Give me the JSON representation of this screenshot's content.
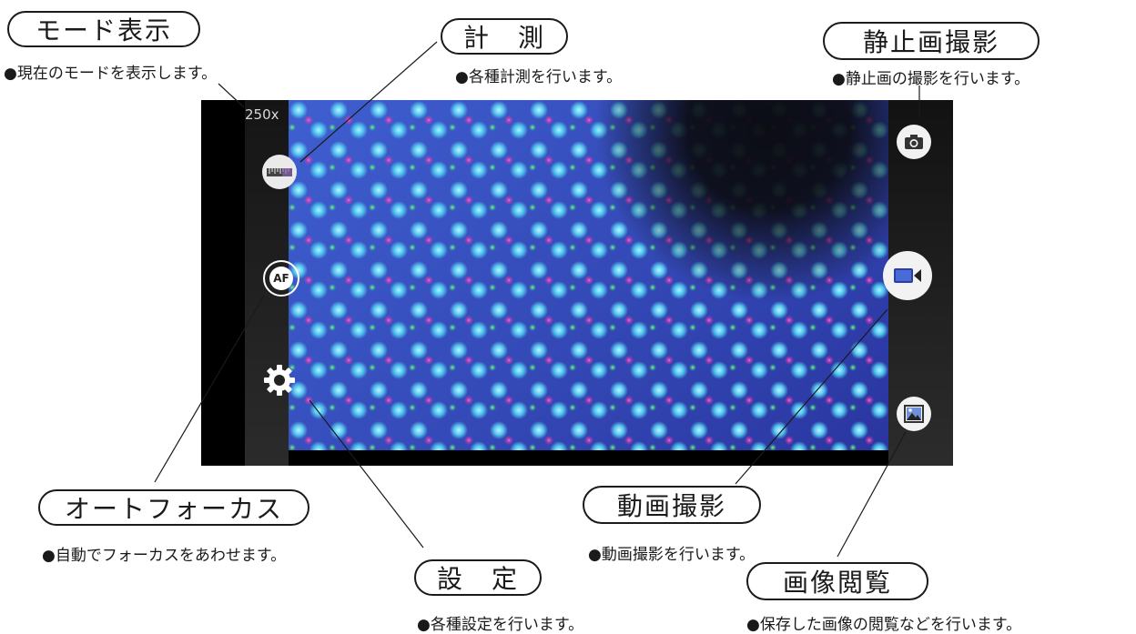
{
  "screen": {
    "mode_value": "250x",
    "buttons": {
      "measure_icon": "ruler-icon",
      "af_label": "AF",
      "settings_icon": "gear-icon",
      "camera_icon": "camera-icon",
      "video_icon": "video-camera-icon",
      "gallery_icon": "image-icon"
    }
  },
  "callouts": {
    "mode_display": {
      "title": "モード表示",
      "desc": "●現在のモードを表示します。"
    },
    "measure": {
      "title": "計　測",
      "desc": "●各種計測を行います。"
    },
    "still_capture": {
      "title": "静止画撮影",
      "desc": "●静止画の撮影を行います。"
    },
    "autofocus": {
      "title": "オートフォーカス",
      "desc": "●自動でフォーカスをあわせます。"
    },
    "settings": {
      "title": "設　定",
      "desc": "●各種設定を行います。"
    },
    "video_capture": {
      "title": "動画撮影",
      "desc": "●動画撮影を行います。"
    },
    "image_view": {
      "title": "画像閲覧",
      "desc": "●保存した画像の閲覧などを行います。"
    }
  },
  "colors": {
    "line": "#1a1a1a",
    "button_bg": "#f2f2f2"
  }
}
